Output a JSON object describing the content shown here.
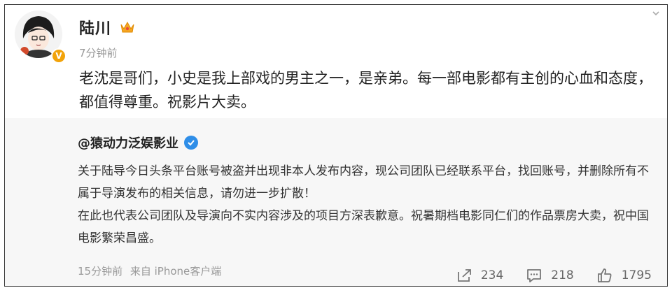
{
  "post": {
    "username": "陆川",
    "time": "7分钟前",
    "text": "老沈是哥们，小史是我上部戏的男主之一，是亲弟。每一部电影都有主创的心血和态度，都值得尊重。祝影片大卖。"
  },
  "repost": {
    "author": "@猿动力泛娱影业",
    "paragraph1": "关于陆导今日头条平台账号被盗并出现非本人发布内容，现公司团队已经联系平台，找回账号，并删除所有不属于导演发布的相关信息，请勿进一步扩散！",
    "paragraph2": "在此也代表公司团队及导演向不实内容涉及的项目方深表歉意。祝暑期档电影同仁们的作品票房大卖，祝中国电影繁荣昌盛。",
    "time": "15分钟前",
    "source": "来自 iPhone客户端",
    "shares": "234",
    "comments": "218",
    "likes": "1795"
  },
  "icons": {
    "avatar": "avatar-cartoon",
    "verified_badge": "orange-v",
    "member_crown": "crown",
    "repost_verified": "blue-v"
  },
  "colors": {
    "verified_orange": "#f2a30a",
    "verified_blue": "#2f8ee8",
    "repost_bg": "#f7f7f7"
  }
}
